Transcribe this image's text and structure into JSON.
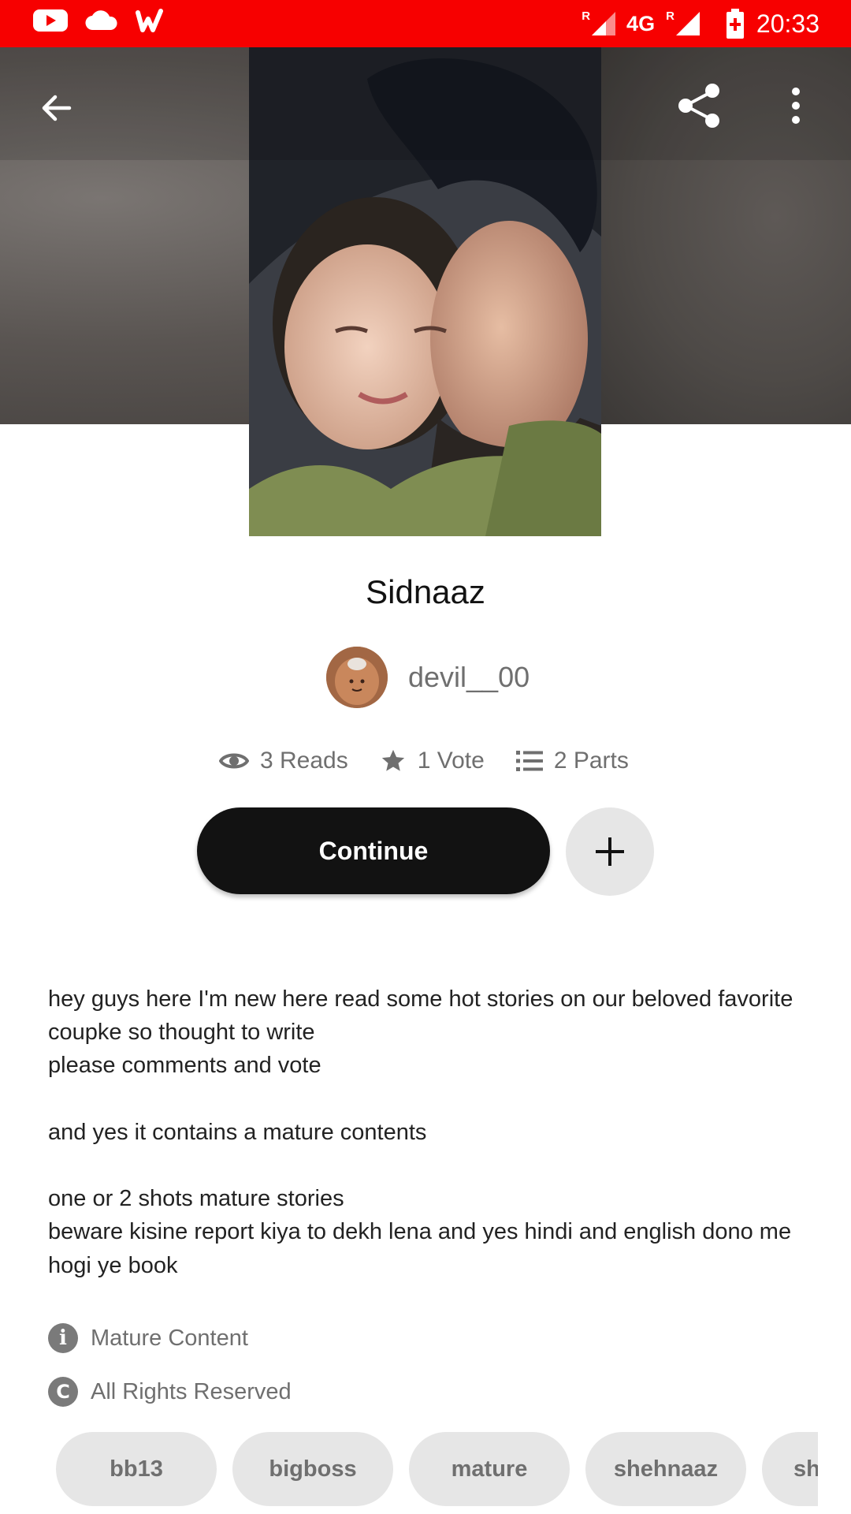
{
  "status_bar": {
    "network": "4G",
    "roaming_1": "R",
    "roaming_2": "R",
    "time": "20:33",
    "color": "#f70000",
    "icons": [
      "youtube-icon",
      "cloud-icon",
      "wattpad-icon",
      "signal-icon",
      "battery-charging-icon"
    ]
  },
  "toolbar": {
    "icons": [
      "back-arrow-icon",
      "share-icon",
      "more-vert-icon"
    ]
  },
  "story": {
    "title": "Sidnaaz",
    "author": "devil__00",
    "reads": "3 Reads",
    "votes": "1 Vote",
    "parts": "2 Parts",
    "continue_label": "Continue",
    "description": [
      "hey guys here I'm new here read some hot stories on our beloved favorite coupke so thought to write",
      "please comments and vote",
      "",
      "and yes it contains a mature contents",
      "",
      "one or 2 shots mature stories",
      "beware kisine report kiya to dekh lena and yes hindi and english dono me hogi ye book"
    ],
    "mature_label": "Mature Content",
    "rights_label": "All Rights Reserved",
    "tags": [
      "bb13",
      "bigboss",
      "mature",
      "shehnaaz",
      "sh"
    ]
  }
}
